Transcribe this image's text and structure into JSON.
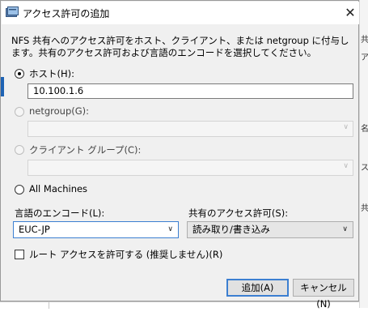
{
  "dialog": {
    "title": "アクセス許可の追加",
    "close_glyph": "✕",
    "description": "NFS 共有へのアクセス許可をホスト、クライアント、または netgroup に付与します。共有のアクセス許可および言語のエンコードを選択してください。"
  },
  "host_option": {
    "label": "ホスト(H):",
    "selected": true,
    "value": "10.100.1.6"
  },
  "netgroup_option": {
    "label": "netgroup(G):",
    "selected": false
  },
  "client_group_option": {
    "label": "クライアント グループ(C):",
    "selected": false
  },
  "all_machines_option": {
    "label": "All Machines",
    "selected": false
  },
  "encoding": {
    "label": "言語のエンコード(L):",
    "value": "EUC-JP"
  },
  "share_access": {
    "label": "共有のアクセス許可(S):",
    "value": "読み取り/書き込み"
  },
  "root_access": {
    "label": "ルート アクセスを許可する (推奨しません)(R)",
    "checked": false
  },
  "buttons": {
    "add": "追加(A)",
    "cancel": "キャンセル(N)"
  },
  "background_window": {
    "letters": [
      "共",
      "ア",
      "名",
      "ス",
      "共"
    ]
  },
  "colors": {
    "accent": "#1e63b4",
    "focus_border": "#3c7fd1",
    "dialog_bg": "#f0f0f0"
  }
}
